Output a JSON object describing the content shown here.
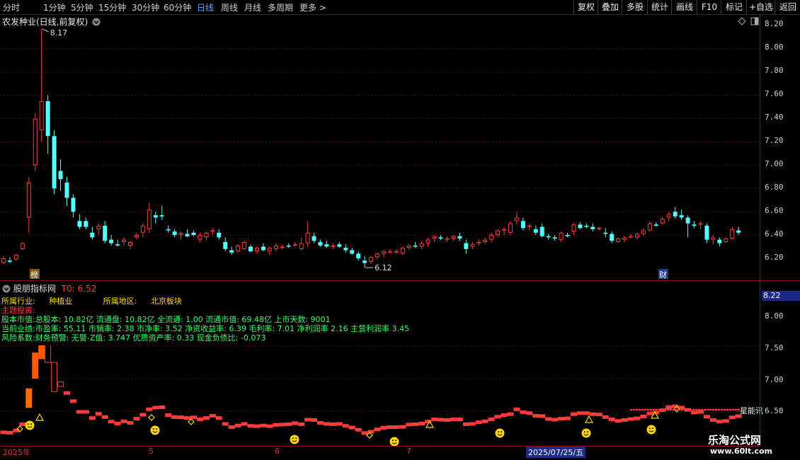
{
  "toolbar": {
    "periods": [
      "分时",
      "1分钟",
      "5分钟",
      "15分钟",
      "30分钟",
      "60分钟",
      "日线",
      "周线",
      "月线",
      "多周期",
      "更多 >"
    ],
    "active_index": 6,
    "right_buttons": [
      "复权",
      "叠加",
      "多股",
      "统计",
      "画线",
      "F10",
      "标记",
      "+自选",
      "返回"
    ]
  },
  "stock": {
    "title": "农发种业(日线,前复权)"
  },
  "price_axis": {
    "ticks": [
      "8.20",
      "8.00",
      "7.80",
      "7.60",
      "7.40",
      "7.20",
      "7.00",
      "6.80",
      "6.60",
      "6.40",
      "6.20"
    ]
  },
  "price_chart": {
    "type": "candlestick",
    "high_label": "8.17",
    "low_label": "6.12",
    "candles": [
      [
        6.16,
        6.22,
        6.15,
        6.2
      ],
      [
        6.18,
        6.21,
        6.16,
        6.17
      ],
      [
        6.19,
        6.24,
        6.18,
        6.23
      ],
      [
        6.28,
        6.34,
        6.27,
        6.33
      ],
      [
        6.55,
        6.9,
        6.42,
        6.85
      ],
      [
        7.0,
        7.45,
        6.95,
        7.4
      ],
      [
        7.3,
        8.17,
        7.2,
        7.55
      ],
      [
        7.55,
        7.6,
        7.1,
        7.25
      ],
      [
        7.25,
        7.3,
        6.75,
        6.8
      ],
      [
        6.95,
        7.05,
        6.78,
        6.88
      ],
      [
        6.85,
        6.9,
        6.65,
        6.72
      ],
      [
        6.72,
        6.75,
        6.55,
        6.6
      ],
      [
        6.52,
        6.58,
        6.45,
        6.47
      ],
      [
        6.52,
        6.55,
        6.45,
        6.47
      ],
      [
        6.42,
        6.47,
        6.36,
        6.38
      ],
      [
        6.45,
        6.5,
        6.4,
        6.48
      ],
      [
        6.48,
        6.52,
        6.33,
        6.35
      ],
      [
        6.36,
        6.4,
        6.31,
        6.33
      ],
      [
        6.32,
        6.36,
        6.3,
        6.31
      ],
      [
        6.34,
        6.38,
        6.31,
        6.36
      ],
      [
        6.31,
        6.35,
        6.28,
        6.34
      ],
      [
        6.38,
        6.42,
        6.36,
        6.4
      ],
      [
        6.42,
        6.5,
        6.38,
        6.48
      ],
      [
        6.45,
        6.68,
        6.42,
        6.62
      ],
      [
        6.57,
        6.6,
        6.5,
        6.55
      ],
      [
        6.57,
        6.65,
        6.53,
        6.56
      ],
      [
        6.45,
        6.48,
        6.42,
        6.44
      ],
      [
        6.43,
        6.45,
        6.38,
        6.4
      ],
      [
        6.4,
        6.43,
        6.36,
        6.42
      ],
      [
        6.41,
        6.45,
        6.38,
        6.39
      ],
      [
        6.42,
        6.44,
        6.39,
        6.4
      ],
      [
        6.36,
        6.42,
        6.34,
        6.4
      ],
      [
        6.38,
        6.43,
        6.35,
        6.42
      ],
      [
        6.43,
        6.46,
        6.4,
        6.44
      ],
      [
        6.42,
        6.45,
        6.36,
        6.38
      ],
      [
        6.34,
        6.38,
        6.26,
        6.28
      ],
      [
        6.27,
        6.3,
        6.23,
        6.25
      ],
      [
        6.26,
        6.32,
        6.25,
        6.31
      ],
      [
        6.28,
        6.35,
        6.27,
        6.34
      ],
      [
        6.3,
        6.32,
        6.25,
        6.26
      ],
      [
        6.26,
        6.3,
        6.24,
        6.29
      ],
      [
        6.3,
        6.33,
        6.26,
        6.27
      ],
      [
        6.26,
        6.3,
        6.23,
        6.29
      ],
      [
        6.28,
        6.33,
        6.26,
        6.31
      ],
      [
        6.3,
        6.32,
        6.28,
        6.3
      ],
      [
        6.31,
        6.33,
        6.29,
        6.3
      ],
      [
        6.32,
        6.34,
        6.3,
        6.32
      ],
      [
        6.28,
        6.38,
        6.27,
        6.33
      ],
      [
        6.33,
        6.52,
        6.3,
        6.42
      ],
      [
        6.39,
        6.42,
        6.33,
        6.35
      ],
      [
        6.34,
        6.36,
        6.3,
        6.31
      ],
      [
        6.32,
        6.35,
        6.29,
        6.3
      ],
      [
        6.3,
        6.33,
        6.28,
        6.31
      ],
      [
        6.32,
        6.34,
        6.29,
        6.3
      ],
      [
        6.29,
        6.32,
        6.25,
        6.27
      ],
      [
        6.27,
        6.29,
        6.23,
        6.24
      ],
      [
        6.24,
        6.26,
        6.18,
        6.2
      ],
      [
        6.18,
        6.22,
        6.12,
        6.16
      ],
      [
        6.17,
        6.22,
        6.15,
        6.21
      ],
      [
        6.21,
        6.25,
        6.19,
        6.24
      ],
      [
        6.24,
        6.27,
        6.21,
        6.26
      ],
      [
        6.26,
        6.28,
        6.24,
        6.26
      ],
      [
        6.26,
        6.28,
        6.24,
        6.26
      ],
      [
        6.24,
        6.3,
        6.23,
        6.29
      ],
      [
        6.29,
        6.32,
        6.27,
        6.31
      ],
      [
        6.31,
        6.34,
        6.29,
        6.3
      ],
      [
        6.3,
        6.35,
        6.28,
        6.33
      ],
      [
        6.33,
        6.38,
        6.3,
        6.36
      ],
      [
        6.37,
        6.4,
        6.34,
        6.39
      ],
      [
        6.38,
        6.4,
        6.36,
        6.37
      ],
      [
        6.37,
        6.39,
        6.34,
        6.37
      ],
      [
        6.37,
        6.4,
        6.35,
        6.39
      ],
      [
        6.39,
        6.42,
        6.35,
        6.37
      ],
      [
        6.33,
        6.36,
        6.24,
        6.28
      ],
      [
        6.3,
        6.34,
        6.28,
        6.32
      ],
      [
        6.33,
        6.36,
        6.31,
        6.34
      ],
      [
        6.34,
        6.38,
        6.32,
        6.36
      ],
      [
        6.36,
        6.42,
        6.34,
        6.4
      ],
      [
        6.4,
        6.45,
        6.38,
        6.44
      ],
      [
        6.44,
        6.47,
        6.4,
        6.45
      ],
      [
        6.42,
        6.52,
        6.4,
        6.5
      ],
      [
        6.52,
        6.6,
        6.49,
        6.55
      ],
      [
        6.52,
        6.55,
        6.44,
        6.46
      ],
      [
        6.47,
        6.5,
        6.44,
        6.48
      ],
      [
        6.45,
        6.48,
        6.4,
        6.42
      ],
      [
        6.47,
        6.5,
        6.38,
        6.39
      ],
      [
        6.39,
        6.41,
        6.36,
        6.38
      ],
      [
        6.38,
        6.4,
        6.35,
        6.37
      ],
      [
        6.36,
        6.43,
        6.34,
        6.42
      ],
      [
        6.4,
        6.42,
        6.38,
        6.39
      ],
      [
        6.43,
        6.5,
        6.4,
        6.49
      ],
      [
        6.49,
        6.51,
        6.45,
        6.46
      ],
      [
        6.48,
        6.5,
        6.46,
        6.47
      ],
      [
        6.47,
        6.5,
        6.43,
        6.45
      ],
      [
        6.45,
        6.47,
        6.44,
        6.46
      ],
      [
        6.42,
        6.46,
        6.38,
        6.41
      ],
      [
        6.41,
        6.43,
        6.33,
        6.35
      ],
      [
        6.34,
        6.38,
        6.33,
        6.37
      ],
      [
        6.36,
        6.39,
        6.34,
        6.38
      ],
      [
        6.38,
        6.41,
        6.37,
        6.39
      ],
      [
        6.38,
        6.42,
        6.36,
        6.41
      ],
      [
        6.41,
        6.46,
        6.39,
        6.44
      ],
      [
        6.44,
        6.52,
        6.43,
        6.5
      ],
      [
        6.49,
        6.51,
        6.47,
        6.48
      ],
      [
        6.5,
        6.56,
        6.49,
        6.54
      ],
      [
        6.55,
        6.6,
        6.52,
        6.58
      ],
      [
        6.6,
        6.64,
        6.54,
        6.56
      ],
      [
        6.57,
        6.62,
        6.53,
        6.55
      ],
      [
        6.55,
        6.57,
        6.38,
        6.5
      ],
      [
        6.49,
        6.52,
        6.46,
        6.48
      ],
      [
        6.49,
        6.52,
        6.45,
        6.5
      ],
      [
        6.48,
        6.5,
        6.33,
        6.36
      ],
      [
        6.36,
        6.4,
        6.32,
        6.38
      ],
      [
        6.36,
        6.38,
        6.3,
        6.33
      ],
      [
        6.34,
        6.38,
        6.33,
        6.37
      ],
      [
        6.37,
        6.47,
        6.36,
        6.45
      ],
      [
        6.44,
        6.47,
        6.4,
        6.42
      ]
    ],
    "bang_marker": "榜",
    "cai_marker": "财"
  },
  "indicator": {
    "name": "股朋指标网",
    "t0_label": "T0: 6.52",
    "industry_label": "所属行业:",
    "industry_value": "种植业",
    "region_label": "所属地区:",
    "region_value": "北京板块",
    "theme_label": "主题投资:",
    "line1": "股本市值:总股本: 10.82亿 流通盘: 10.82亿 全流通: 1.00 流通市值: 69.48亿 上市天数: 9001",
    "line2": "当前业绩:市盈率: 55.11 市销率: 2.38 市净率: 3.52 净资收益率: 6.39 毛利率: 7.01 净利润率 2.16 主营利润率 3.45",
    "line3": "风险系数:财务预警: 无警-Z值: 3.747 优质资产率: 0.33 现金负债比: -0.073",
    "axis_current": "8.22",
    "axis_ticks": [
      "8.00",
      "7.50",
      "7.00",
      "6.50"
    ],
    "right_label": "星能讯"
  },
  "date_axis": {
    "labels": [
      "2025年",
      "5",
      "6",
      "7",
      "2025/07/25/五"
    ]
  },
  "watermark": {
    "line1": "乐淘公式网",
    "line2": "www.60lt.com"
  },
  "colors": {
    "up": "#ff3b3b",
    "down": "#54ffff",
    "axis_line": "#7a1010",
    "active_tab": "#5aa7ff",
    "label_yellow": "#ffd700",
    "label_red": "#ff3b3b",
    "info_green": "#33ff66"
  }
}
